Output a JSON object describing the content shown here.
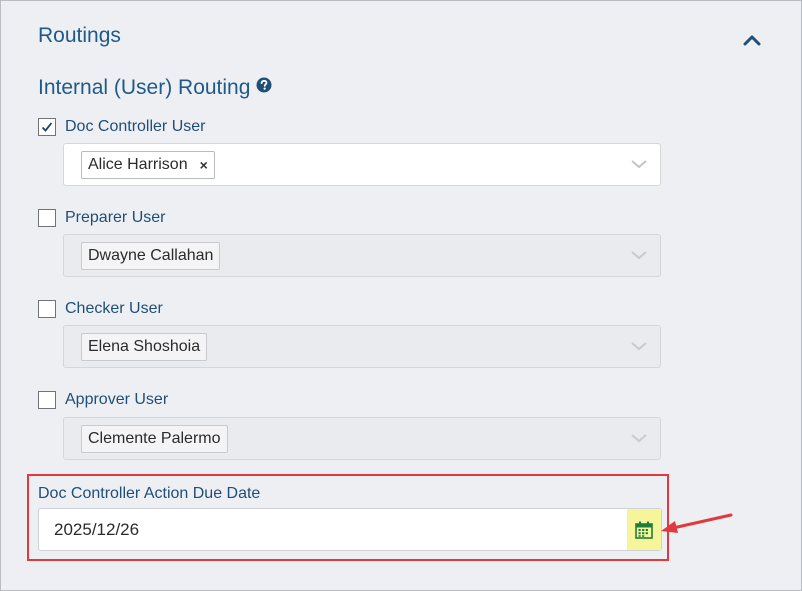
{
  "routings": {
    "title": "Routings",
    "collapse_icon": "chevron-up-icon"
  },
  "internal_routing": {
    "title": "Internal (User) Routing",
    "help_icon": "question-circle-icon"
  },
  "doc_controller": {
    "label": "Doc Controller User",
    "checked": true,
    "selected_user": "Alice Harrison",
    "remove_label": "×"
  },
  "preparer": {
    "label": "Preparer User",
    "checked": false,
    "selected_user": "Dwayne Callahan"
  },
  "checker": {
    "label": "Checker User",
    "checked": false,
    "selected_user": "Elena Shoshoia"
  },
  "approver": {
    "label": "Approver User",
    "checked": false,
    "selected_user": "Clemente Palermo"
  },
  "due_date": {
    "label": "Doc Controller Action Due Date",
    "value": "2025/12/26",
    "calendar_icon": "calendar-icon"
  },
  "colors": {
    "heading": "#1f5a8a",
    "highlight_border": "#e0393e",
    "calendar_highlight": "#f7f59a",
    "calendar_icon": "#1e7f3c"
  }
}
